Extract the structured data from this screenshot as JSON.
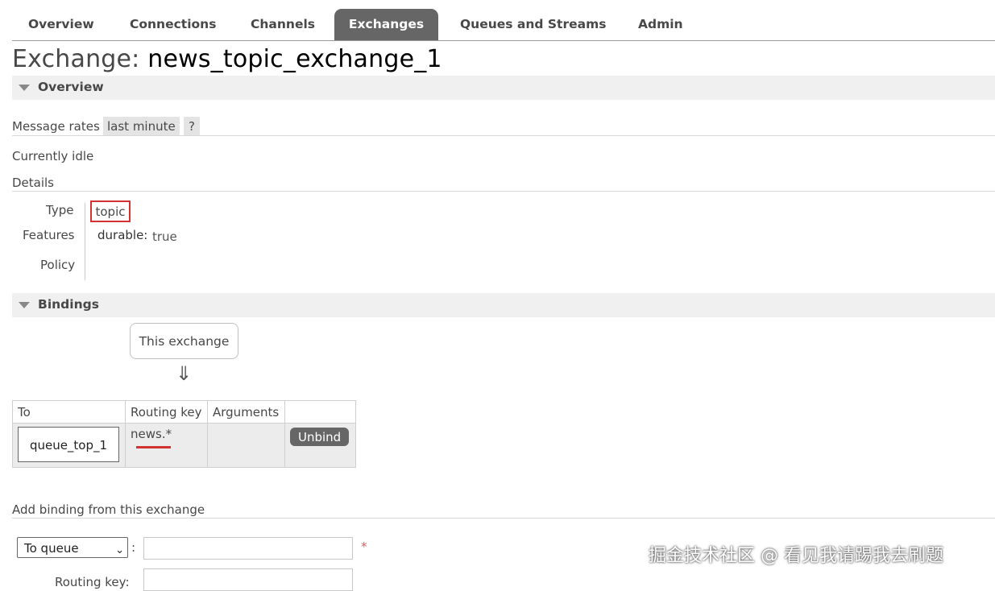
{
  "nav": {
    "tabs": [
      {
        "label": "Overview",
        "active": false
      },
      {
        "label": "Connections",
        "active": false
      },
      {
        "label": "Channels",
        "active": false
      },
      {
        "label": "Exchanges",
        "active": true
      },
      {
        "label": "Queues and Streams",
        "active": false
      },
      {
        "label": "Admin",
        "active": false
      }
    ]
  },
  "page": {
    "title_prefix": "Exchange:",
    "title_name": "news_topic_exchange_1"
  },
  "overview": {
    "section_label": "Overview",
    "message_rates_label": "Message rates",
    "message_rates_value": "last minute",
    "help_label": "?",
    "idle_text": "Currently idle",
    "details_label": "Details",
    "type_label": "Type",
    "type_value": "topic",
    "features_label": "Features",
    "feature_key": "durable:",
    "feature_value": "true",
    "policy_label": "Policy"
  },
  "bindings": {
    "section_label": "Bindings",
    "this_exchange": "This exchange",
    "arrow": "⇓",
    "columns": [
      "To",
      "Routing key",
      "Arguments",
      ""
    ],
    "rows": [
      {
        "to": "queue_top_1",
        "routing_key": "news.*",
        "arguments": "",
        "action": "Unbind"
      }
    ]
  },
  "add_binding": {
    "label": "Add binding from this exchange",
    "destination_type": "To queue",
    "colon": ":",
    "required_mark": "*",
    "routing_key_label": "Routing key:"
  },
  "watermark": "掘金技术社区 @ 看见我请踢我去刷题",
  "colors": {
    "active_tab": "#666666",
    "highlight_red": "#d23232",
    "section_bg": "#f0f0f0"
  }
}
